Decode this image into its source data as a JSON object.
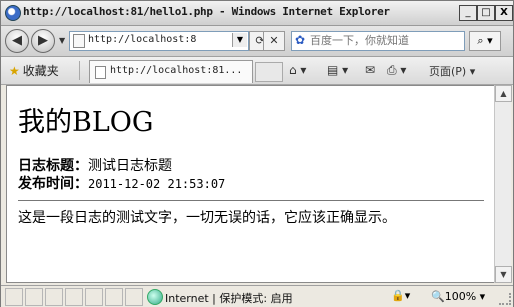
{
  "window": {
    "title": "http://localhost:81/hello1.php - Windows Internet Explorer",
    "min_label": "_",
    "max_label": "□",
    "close_label": "X"
  },
  "nav": {
    "url": "http://localhost:8",
    "search_placeholder": "百度一下，你就知道"
  },
  "favbar": {
    "favorites_label": "收藏夹",
    "tab_label": "http://localhost:81...",
    "page_menu": "页面(P)"
  },
  "page": {
    "heading": "我的BLOG",
    "title_label": "日志标题：",
    "title_value": "测试日志标题",
    "time_label": "发布时间：",
    "time_value": "2011-12-02 21:53:07",
    "body": "这是一段日志的测试文字，一切无误的话，它应该正确显示。"
  },
  "status": {
    "zone": "Internet | 保护模式: 启用",
    "zoom": "100%"
  },
  "icons": [
    "ie-icon",
    "back-icon",
    "forward-icon",
    "refresh-icon",
    "stop-icon",
    "search-icon",
    "star-icon",
    "home-icon",
    "feed-icon",
    "mail-icon",
    "print-icon",
    "globe-icon",
    "lock-icon",
    "zoom-icon"
  ]
}
